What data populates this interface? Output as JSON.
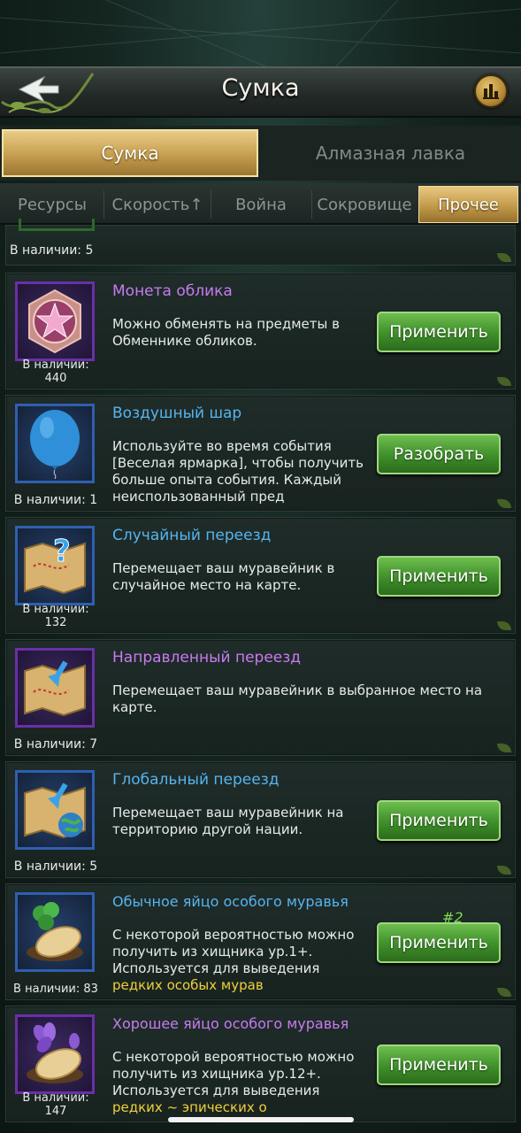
{
  "header": {
    "title": "Сумка"
  },
  "main_tabs": [
    {
      "label": "Сумка",
      "active": true
    },
    {
      "label": "Алмазная лавка",
      "active": false
    }
  ],
  "sub_tabs": [
    {
      "label": "Ресурсы",
      "active": false
    },
    {
      "label": "Скорость↑",
      "active": false
    },
    {
      "label": "Война",
      "active": false
    },
    {
      "label": "Сокровище",
      "active": false
    },
    {
      "label": "Прочее",
      "active": true
    }
  ],
  "partial_item": {
    "qty": "В наличии: 5"
  },
  "items": [
    {
      "name": "Монета облика",
      "name_color": "purple",
      "desc": "Можно обменять на предметы в Обменнике обликов.",
      "qty": "В наличии: 440",
      "button": "Применить",
      "icon": "skin-coin-icon"
    },
    {
      "name": "Воздушный шар",
      "name_color": "blue",
      "desc": "Используйте во время события [Веселая ярмарка], чтобы получить больше опыта события. Каждый неиспользованный пред",
      "qty": "В наличии: 1",
      "button": "Разобрать",
      "icon": "balloon-icon"
    },
    {
      "name": "Случайный переезд",
      "name_color": "blue",
      "desc": "Перемещает ваш муравейник в случайное место на карте.",
      "qty": "В наличии: 132",
      "button": "Применить",
      "icon": "random-relocate-map-icon"
    },
    {
      "name": "Направленный переезд",
      "name_color": "purple",
      "desc": "Перемещает ваш муравейник в выбранное место на карте.",
      "qty": "В наличии: 7",
      "button": "",
      "icon": "targeted-relocate-map-icon"
    },
    {
      "name": "Глобальный переезд",
      "name_color": "blue",
      "desc": "Перемещает ваш муравейник на территорию другой нации.",
      "qty": "В наличии: 5",
      "button": "Применить",
      "icon": "global-relocate-map-icon"
    },
    {
      "name": "Обычное яйцо особого муравья",
      "name_color": "blue",
      "desc_plain": "С некоторой вероятностью можно получить из хищника ур.1+. Используется для выведения ",
      "desc_highlight": "редких особых мурав",
      "qty": "В наличии: 83",
      "button": "Применить",
      "badge": "#2",
      "icon": "clover-egg-icon"
    },
    {
      "name": "Хорошее яйцо особого муравья",
      "name_color": "purple",
      "desc_plain": "С некоторой вероятностью можно получить из хищника ур.12+. Используется для выведения ",
      "desc_highlight": "редких ~ эпических о",
      "qty": "В наличии: 147",
      "button": "Применить",
      "icon": "flower-egg-icon"
    }
  ],
  "colors": {
    "accent_gold": "#c9a254",
    "button_green": "#3f8f2b",
    "name_purple": "#c77bf0",
    "name_blue": "#56b4ef",
    "highlight_yellow": "#f0cf3a"
  }
}
